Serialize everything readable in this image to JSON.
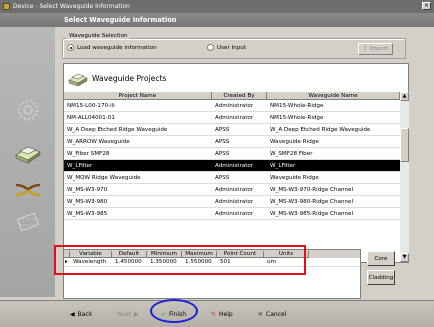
{
  "window": {
    "title": "Device - Select Waveguide Information",
    "header": "Select Waveguide Information"
  },
  "selection": {
    "legend": "Waveguide Selection",
    "radio_load": "Load waveguide information",
    "radio_user": "User Input",
    "import_label": "Import"
  },
  "projects": {
    "title": "Waveguide Projects",
    "columns": [
      "Project Name",
      "Created By",
      "Waveguide Name"
    ],
    "rows": [
      [
        "NM15-L00-170-ili",
        "Administrator",
        "NM15-Whole-Ridge"
      ],
      [
        "NM-ALL04001-01",
        "Administrator",
        "NM15-Whole-Ridge"
      ],
      [
        "W_A Deep Etched Ridge Waveguide",
        "APSS",
        "W_A Deep Etched Ridge Waveguide"
      ],
      [
        "W_ARROW Waveguide",
        "APSS",
        "Waveguide Ridge"
      ],
      [
        "W_Fiber SMF28",
        "APSS",
        "W_SMF28 Fiber"
      ],
      [
        "W_LFilter",
        "Administrator",
        "W_LFilter"
      ],
      [
        "W_MQW Ridge Waveguide",
        "APSS",
        "Waveguide Ridge"
      ],
      [
        "W_MS-W3-970",
        "Administrator",
        "W_MS-W3-970-Ridge Channel"
      ],
      [
        "W_MS-W3-980",
        "Administrator",
        "W_MS-W3-980-Ridge Channel"
      ],
      [
        "W_MS-W3-985",
        "Administrator",
        "W_MS-W3-985-Ridge Channel"
      ]
    ],
    "selected_index": 5
  },
  "parameters": {
    "columns": [
      "Variable",
      "Default",
      "Minimum",
      "Maximum",
      "Point Count",
      "Units"
    ],
    "row": [
      "Wavelength",
      "1.450000",
      "1.350000",
      "1.550000",
      "501",
      "um"
    ]
  },
  "side_buttons": {
    "core": "Core",
    "cladding": "Cladding"
  },
  "footer": {
    "back": "Back",
    "next": "Next",
    "finish": "Finish",
    "help": "Help",
    "cancel": "Cancel"
  },
  "colors": {
    "highlight_red": "#e0101a",
    "highlight_blue": "#1a22d8",
    "selected_row": "#000000"
  }
}
